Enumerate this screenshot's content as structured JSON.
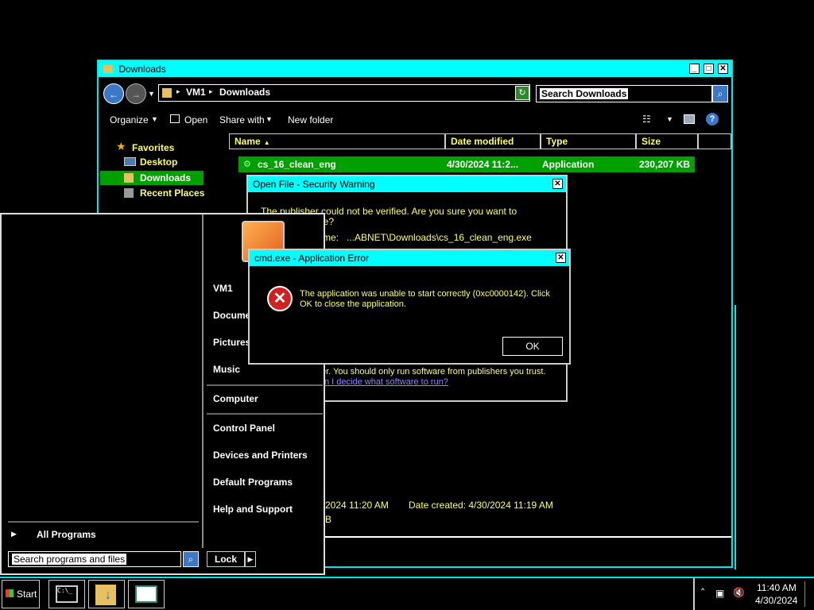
{
  "explorer": {
    "title": "Downloads",
    "path_root": "VM1",
    "path_leaf": "Downloads",
    "search_placeholder": "Search Downloads",
    "toolbar": {
      "organize": "Organize",
      "open": "Open",
      "share": "Share with",
      "new_folder": "New folder"
    },
    "nav": {
      "favorites": "Favorites",
      "desktop": "Desktop",
      "downloads": "Downloads",
      "recent": "Recent Places"
    },
    "columns": {
      "name": "Name",
      "date": "Date modified",
      "type": "Type",
      "size": "Size"
    },
    "file": {
      "name": "cs_16_clean_eng",
      "date": "4/30/2024 11:2...",
      "type": "Application",
      "size": "230,207 KB"
    },
    "details": {
      "modified_tail": "2024 11:20 AM",
      "created": "Date created: 4/30/2024 11:19 AM",
      "size_tail": "B"
    }
  },
  "security_warning": {
    "title": "Open File - Security Warning",
    "line1": "The publisher could not be verified.  Are you sure you want to",
    "line2": "are?",
    "name_label": "me:",
    "name_value": "...ABNET\\Downloads\\cs_16_clean_eng.exe",
    "footer1": "er.  You should only run software from publishers you trust.",
    "footer_link": "n I decide what software to run?"
  },
  "error_dialog": {
    "title": "cmd.exe - Application Error",
    "message": "The application was unable to start correctly (0xc0000142). Click OK to close the application.",
    "ok": "OK"
  },
  "start_menu": {
    "user": "VM1",
    "documents": "Docume",
    "pictures": "Pictures",
    "music": "Music",
    "computer": "Computer",
    "control_panel": "Control Panel",
    "devices": "Devices and Printers",
    "defaults": "Default Programs",
    "help": "Help and Support",
    "all_programs": "All Programs",
    "search_placeholder": "Search programs and files",
    "lock": "Lock"
  },
  "taskbar": {
    "start": "Start",
    "time": "11:40 AM",
    "date": "4/30/2024"
  },
  "colors": {
    "accent": "#00ffff",
    "highlight": "#00a000",
    "text": "#ffff66"
  }
}
